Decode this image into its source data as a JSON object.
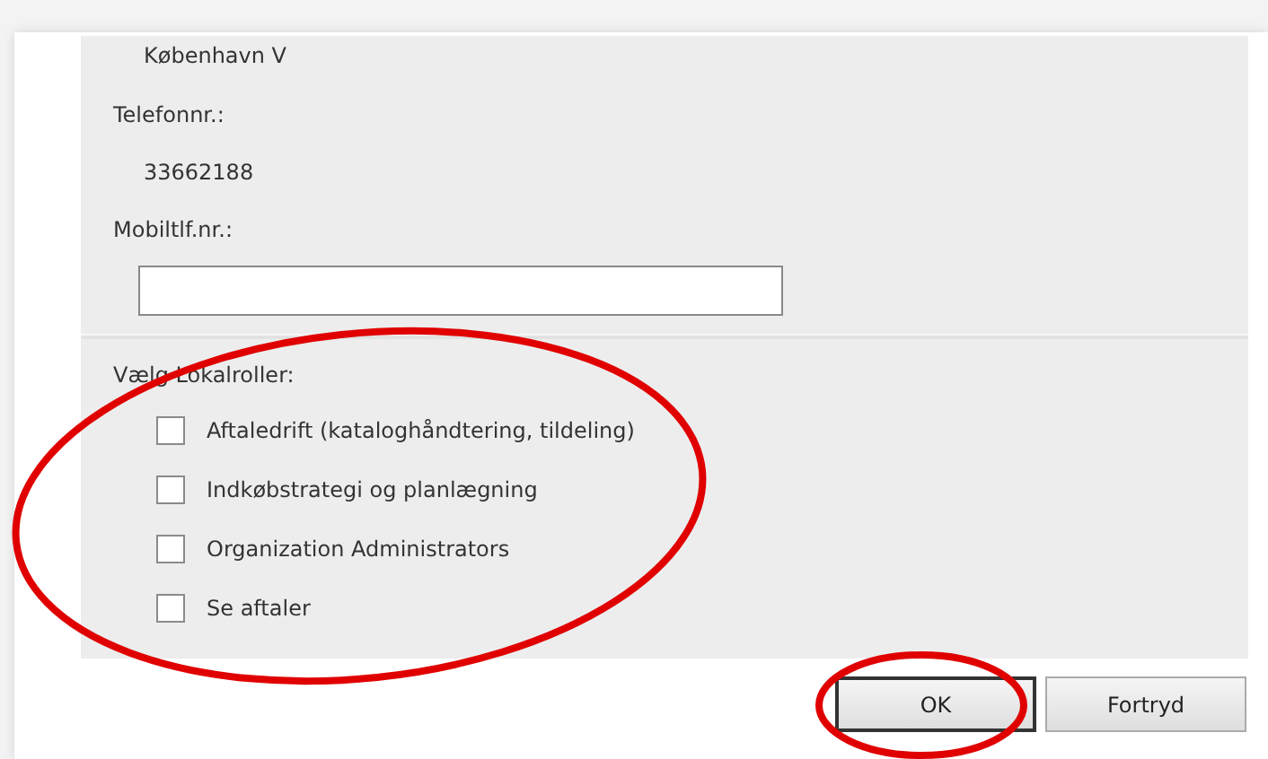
{
  "address_line": "København V",
  "fields": [
    {
      "label": "Telefonnr.:",
      "kind": "text",
      "value": "33662188"
    },
    {
      "label": "Mobiltlf.nr.:",
      "kind": "input"
    }
  ],
  "roles": {
    "label": "Vælg Lokalroller:",
    "items": [
      {
        "label": "Aftaledrift (kataloghåndtering, tildeling)",
        "checked": false
      },
      {
        "label": "Indkøbstrategi og planlægning",
        "checked": false
      },
      {
        "label": "Organization Administrators",
        "checked": false
      },
      {
        "label": "Se aftaler",
        "checked": false
      }
    ]
  },
  "buttons": [
    {
      "label": "OK",
      "selected": true
    },
    {
      "label": "Fortryd",
      "selected": false
    }
  ]
}
